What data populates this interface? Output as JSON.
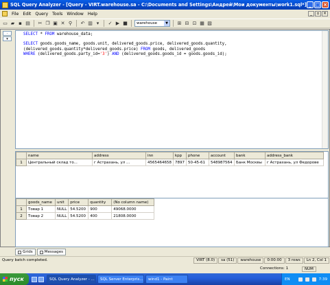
{
  "window": {
    "title": "SQL Query Analyzer - [Query - VIRT.warehouse.sa - C:\\Documents and Settings\\Андрей\\Мои документы\\work1.sql*]"
  },
  "menu": [
    "File",
    "Edit",
    "Query",
    "Tools",
    "Window",
    "Help"
  ],
  "toolbar": {
    "database": "warehouse"
  },
  "editor": {
    "lines": [
      "SELECT * FROM warehouse_data;",
      "",
      "SELECT goods.goods_name, goods.unit, delivered_goods.price, delivered_goods.quantity,",
      "(delivered_goods.quantity*delivered_goods.price) FROM goods, delivered_goods",
      "WHERE (delivered_goods.party_id='3') AND (delivered_goods.goods_id = goods.goods_id);"
    ]
  },
  "grid1": {
    "columns": [
      "name",
      "address",
      "inn",
      "kpp",
      "phone",
      "account",
      "bank",
      "address_bank"
    ],
    "rows": [
      [
        "1",
        "Центральный склад то...",
        "г Астрахань, ул ...",
        "4565464658",
        "7897",
        "50-45-61",
        "548987564",
        "Банк Москвы",
        "г Астрахань, ул Федорове"
      ]
    ]
  },
  "grid2": {
    "columns": [
      "goods_name",
      "unit",
      "price",
      "quantity",
      "(No column name)"
    ],
    "rows": [
      [
        "1",
        "Товар 1",
        "NULL",
        "54.5200",
        "900",
        "49068.0000"
      ],
      [
        "2",
        "Товар 2",
        "NULL",
        "54.5200",
        "400",
        "21808.0000"
      ]
    ]
  },
  "result_tabs": [
    "Grids",
    "Messages"
  ],
  "status": {
    "message": "Query batch completed.",
    "server": "VIRT (8.0)",
    "user": "sa (51)",
    "database": "warehouse",
    "elapsed": "0:00:00",
    "rows": "3 rows",
    "position": "Ln 2, Col 1",
    "connections": "Connections: 1",
    "num": "NUM"
  },
  "taskbar": {
    "start": "пуск",
    "tasks": [
      "SQL Query Analyzer - ...",
      "SQL Server Enterpris...",
      "wind1 - Paint"
    ],
    "lang": "EN",
    "clock": "7:39"
  }
}
